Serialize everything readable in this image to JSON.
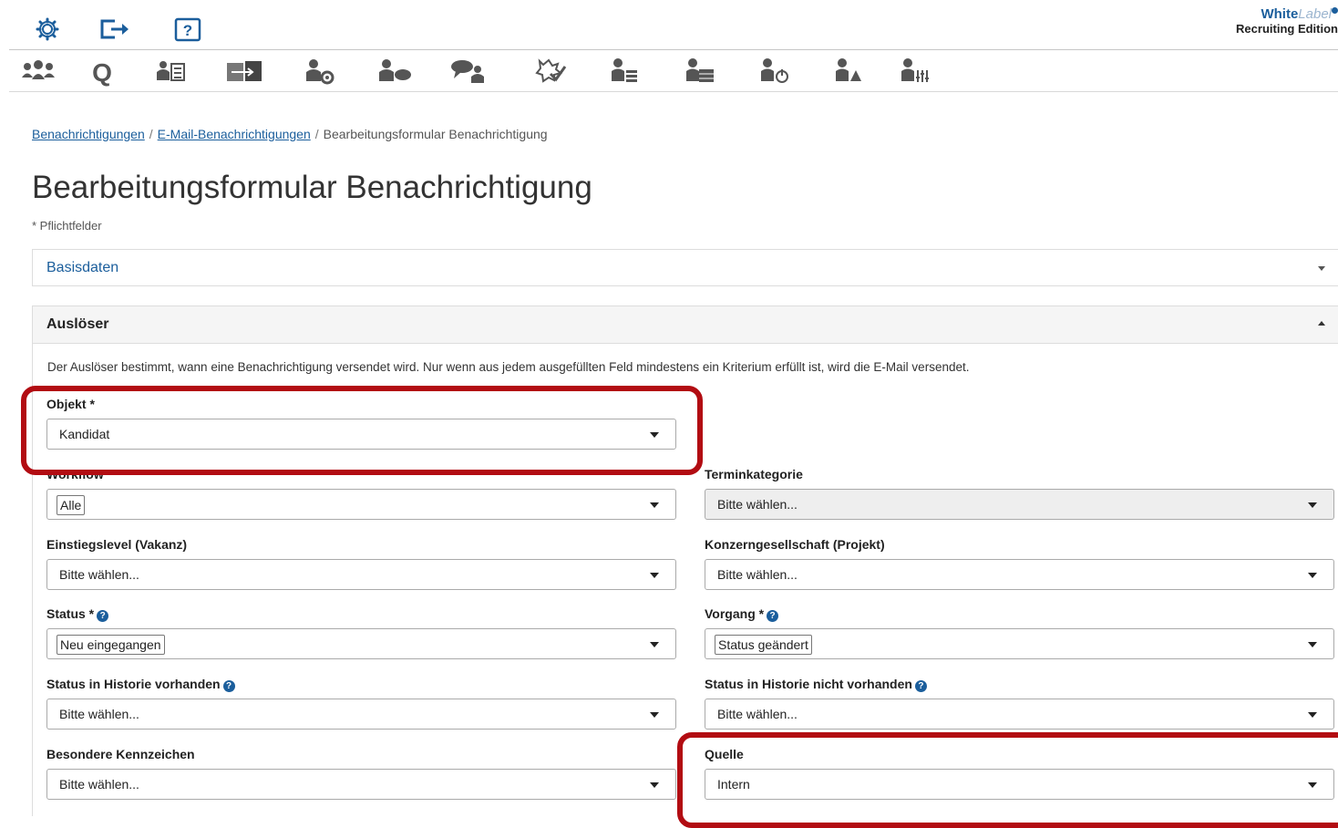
{
  "brand": {
    "name": "White",
    "label": "Label",
    "edition": "Recruiting Edition"
  },
  "topbar": {
    "icons": [
      "gear-icon",
      "logout-icon",
      "help-icon"
    ]
  },
  "toolbar": {
    "icons": [
      "people-network-icon",
      "search-q-icon",
      "candidate-list-icon",
      "transfer-icon",
      "user-settings-icon",
      "user-chat-icon",
      "chat-bubbles-icon",
      "check-stamp-icon",
      "user-list-icon",
      "user-table-icon",
      "user-power-icon",
      "user-alert-icon",
      "user-sliders-icon"
    ],
    "search_label": "Q"
  },
  "breadcrumb": {
    "items": [
      "Benachrichtigungen",
      "E-Mail-Benachrichtigungen"
    ],
    "current": "Bearbeitungsformular Benachrichtigung",
    "separator": "/"
  },
  "page": {
    "title": "Bearbeitungsformular Benachrichtigung",
    "required_note": "* Pflichtfelder"
  },
  "panels": {
    "basis": "Basisdaten",
    "trigger": "Auslöser"
  },
  "trigger": {
    "description": "Der Auslöser bestimmt, wann eine Benachrichtigung versendet wird. Nur wenn aus jedem ausgefüllten Feld mindestens ein Kriterium erfüllt ist, wird die E-Mail versendet.",
    "fields": {
      "objekt": {
        "label": "Objekt *",
        "value": "Kandidat"
      },
      "workflow": {
        "label": "Workflow",
        "value": "Alle"
      },
      "terminkategorie": {
        "label": "Terminkategorie",
        "value": "Bitte wählen..."
      },
      "einstiegslevel": {
        "label": "Einstiegslevel (Vakanz)",
        "value": "Bitte wählen..."
      },
      "konzerngesellschaft": {
        "label": "Konzerngesellschaft (Projekt)",
        "value": "Bitte wählen..."
      },
      "status": {
        "label": "Status *",
        "value": "Neu eingegangen"
      },
      "vorgang": {
        "label": "Vorgang *",
        "value": "Status geändert"
      },
      "status_historie_vorhanden": {
        "label": "Status in Historie vorhanden",
        "value": "Bitte wählen..."
      },
      "status_historie_nicht": {
        "label": "Status in Historie nicht vorhanden",
        "value": "Bitte wählen..."
      },
      "kennzeichen": {
        "label": "Besondere Kennzeichen",
        "value": "Bitte wählen..."
      },
      "quelle": {
        "label": "Quelle",
        "value": "Intern"
      }
    },
    "help_glyph": "?"
  },
  "colors": {
    "link": "#1b5e9c",
    "highlight": "#b20c12",
    "panel_header": "#f5f5f5"
  }
}
